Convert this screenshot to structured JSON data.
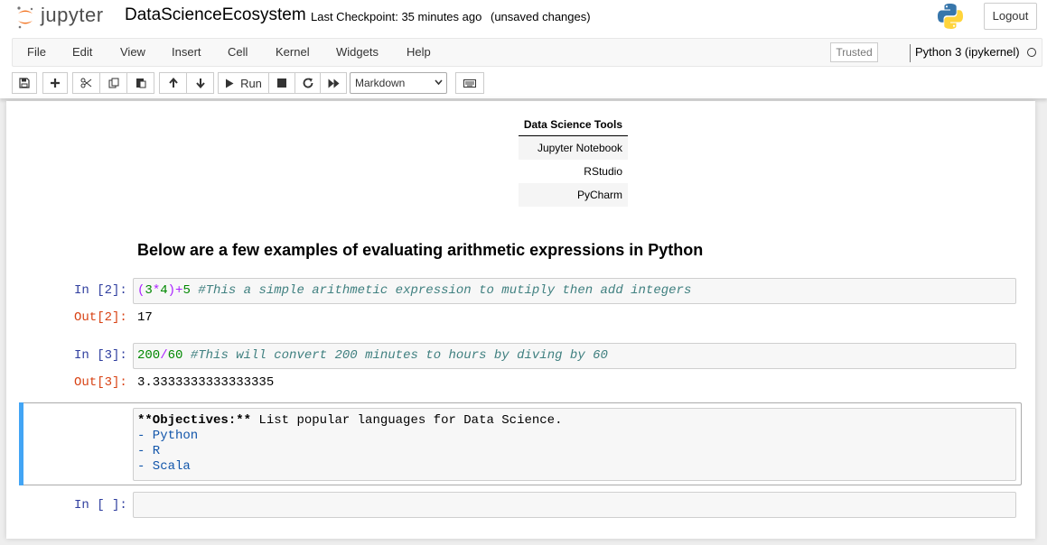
{
  "header": {
    "logo_text": "jupyter",
    "notebook_title": "DataScienceEcosystem",
    "checkpoint": "Last Checkpoint: 35 minutes ago",
    "status": "(unsaved changes)",
    "logout_label": "Logout"
  },
  "menu": {
    "items": [
      "File",
      "Edit",
      "View",
      "Insert",
      "Cell",
      "Kernel",
      "Widgets",
      "Help"
    ],
    "trusted_label": "Trusted",
    "kernel_name": "Python 3 (ipykernel)"
  },
  "toolbar": {
    "run_label": "Run",
    "cell_type": "Markdown",
    "icons": [
      "save-icon",
      "plus-icon",
      "cut-icon",
      "copy-icon",
      "paste-icon",
      "arrow-up-icon",
      "arrow-down-icon",
      "run-icon",
      "stop-icon",
      "restart-icon",
      "fast-forward-icon",
      "keyboard-icon"
    ]
  },
  "table": {
    "header": "Data Science Tools",
    "rows": [
      "Jupyter Notebook",
      "RStudio",
      "PyCharm"
    ]
  },
  "heading": "Below are a few examples of evaluating arithmetic expressions in Python",
  "cells": [
    {
      "in_prompt": "In [2]:",
      "code": "(3*4)+5",
      "comment": "#This a simple arithmetic expression to mutiply then add integers",
      "out_prompt": "Out[2]:",
      "output": "17"
    },
    {
      "in_prompt": "In [3]:",
      "code": "200/60",
      "comment": "#This will convert 200 minutes to hours by diving by 60",
      "out_prompt": "Out[3]:",
      "output": "3.3333333333333335"
    }
  ],
  "markdown_cell": {
    "line1_bold": "**Objectives:**",
    "line1_rest": " List popular languages for Data Science.",
    "list": [
      "- Python",
      "- R",
      "- Scala"
    ]
  },
  "empty_cell": {
    "in_prompt": "In [ ]:"
  },
  "colors": {
    "in_prompt": "#303f9f",
    "out_prompt": "#d84315",
    "selected_bar": "#42a5f5",
    "jupyter_orange": "#f37726"
  }
}
